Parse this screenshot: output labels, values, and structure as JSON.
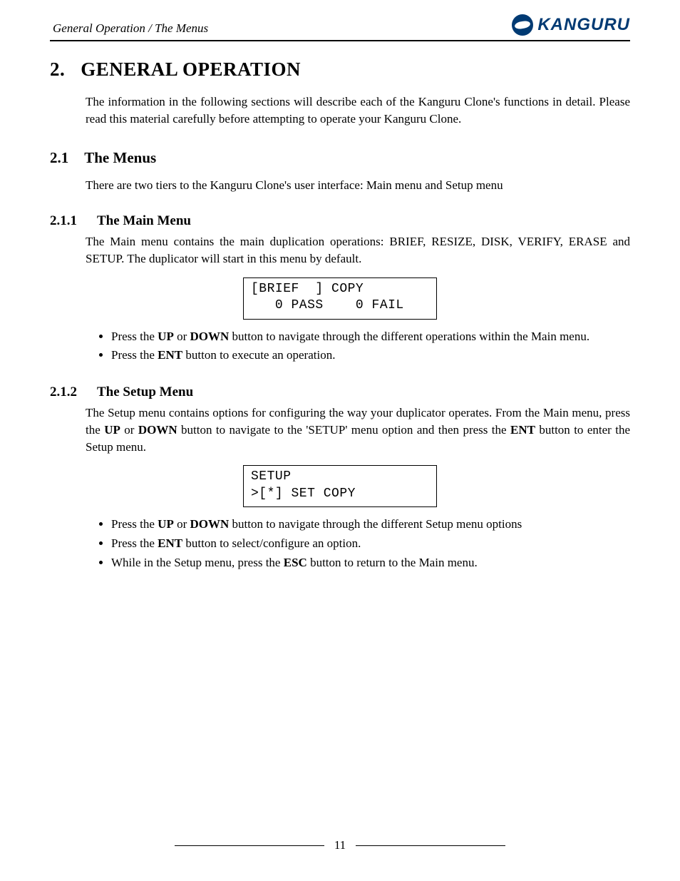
{
  "header": {
    "breadcrumb": "General Operation / The Menus",
    "brand": "KANGURU"
  },
  "h1_num": "2.",
  "h1_text": "GENERAL OPERATION",
  "intro": "The information in the following sections will describe each of the Kanguru Clone's functions in detail. Please read this material carefully before attempting to operate your Kanguru Clone.",
  "h2_1_num": "2.1",
  "h2_1_text": "The Menus",
  "p_2_1": "There are two tiers to the Kanguru Clone's user interface: Main menu and Setup menu",
  "h3_1_num": "2.1.1",
  "h3_1_text": "The Main Menu",
  "p_2_1_1": "The Main menu contains the main duplication operations: BRIEF, RESIZE, DISK, VERIFY, ERASE and SETUP. The duplicator will start in this menu by default.",
  "lcd1_line1": "[BRIEF  ] COPY",
  "lcd1_line2": "   0 PASS    0 FAIL",
  "bullets_211": {
    "b1_a": "Press the ",
    "b1_b": "UP",
    "b1_c": " or ",
    "b1_d": "DOWN",
    "b1_e": " button to navigate through the different operations within the Main menu.",
    "b2_a": "Press the ",
    "b2_b": "ENT",
    "b2_c": " button to execute an operation."
  },
  "h3_2_num": "2.1.2",
  "h3_2_text": "The Setup Menu",
  "p_2_1_2_a": "The Setup menu contains options for configuring the way your duplicator operates. From the Main menu, press the ",
  "p_2_1_2_b": "UP",
  "p_2_1_2_c": " or ",
  "p_2_1_2_d": "DOWN",
  "p_2_1_2_e": " button to navigate to the 'SETUP' menu option and then press the ",
  "p_2_1_2_f": "ENT",
  "p_2_1_2_g": " button to enter the Setup menu.",
  "lcd2_line1": "SETUP",
  "lcd2_line2": ">[*] SET COPY",
  "bullets_212": {
    "b1_a": "Press the ",
    "b1_b": "UP",
    "b1_c": " or ",
    "b1_d": "DOWN",
    "b1_e": " button to navigate through the different Setup menu options",
    "b2_a": "Press the ",
    "b2_b": "ENT",
    "b2_c": " button to select/configure an option.",
    "b3_a": "While in the Setup menu, press the ",
    "b3_b": "ESC",
    "b3_c": " button to return to the Main menu."
  },
  "page_number": "11"
}
